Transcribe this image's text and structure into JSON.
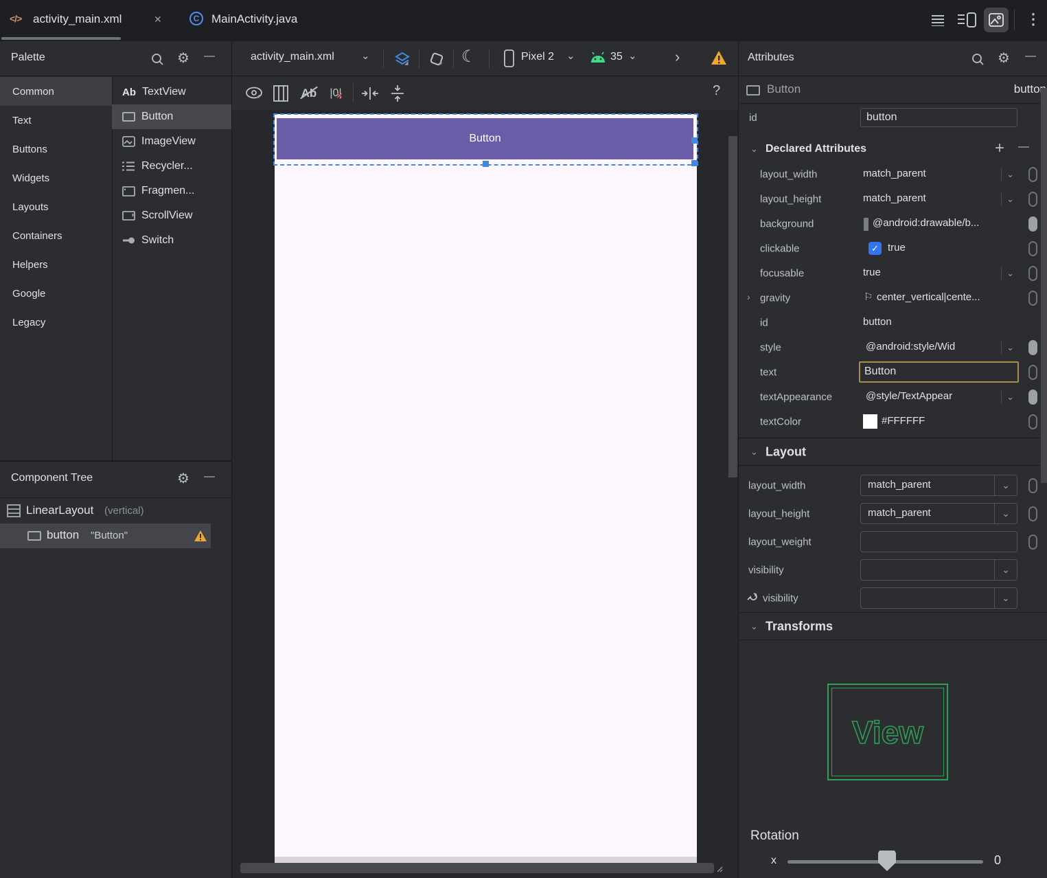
{
  "glyphs": {
    "close": "✕",
    "chevron_down": "⌄",
    "chevron_right": "›",
    "kebab": "⋮",
    "moon": "☾",
    "help": "?",
    "minus": "—",
    "plus": "+",
    "check": "✓",
    "flag": "⚐",
    "gear": "⚙",
    "xml_tag": "</>",
    "java_class": "C",
    "ab": "Ab",
    "weights": "|0|",
    "weights_x": "×",
    "expand": "›"
  },
  "tab_bar": {
    "tabs": [
      {
        "label": "activity_main.xml",
        "active": true
      },
      {
        "label": "MainActivity.java",
        "active": false
      }
    ]
  },
  "palette": {
    "title": "Palette",
    "categories": [
      "Common",
      "Text",
      "Buttons",
      "Widgets",
      "Layouts",
      "Containers",
      "Helpers",
      "Google",
      "Legacy"
    ],
    "selected_category": "Common",
    "components": [
      {
        "label": "TextView"
      },
      {
        "label": "Button"
      },
      {
        "label": "ImageView"
      },
      {
        "label": "Recycler..."
      },
      {
        "label": "Fragmen..."
      },
      {
        "label": "ScrollView"
      },
      {
        "label": "Switch"
      }
    ],
    "selected_component": "Button"
  },
  "component_tree": {
    "title": "Component Tree",
    "root": {
      "label": "LinearLayout",
      "suffix": "(vertical)"
    },
    "child": {
      "label": "button",
      "text": "\"Button\""
    }
  },
  "design_toolbar": {
    "file": "activity_main.xml",
    "device": "Pixel 2",
    "api": "35"
  },
  "canvas": {
    "button_label": "Button"
  },
  "attributes": {
    "title": "Attributes",
    "component": {
      "type": "Button",
      "id": "button"
    },
    "id_row": {
      "label": "id",
      "value": "button"
    },
    "declared": {
      "title": "Declared Attributes",
      "rows": [
        {
          "name": "layout_width",
          "value": "match_parent"
        },
        {
          "name": "layout_height",
          "value": "match_parent"
        },
        {
          "name": "background",
          "value": "@android:drawable/b..."
        },
        {
          "name": "clickable",
          "value": "true"
        },
        {
          "name": "focusable",
          "value": "true"
        },
        {
          "name": "gravity",
          "value": "center_vertical|cente..."
        },
        {
          "name": "id",
          "value": "button"
        },
        {
          "name": "style",
          "value": "@android:style/Wid"
        },
        {
          "name": "text",
          "value": "Button"
        },
        {
          "name": "textAppearance",
          "value": "@style/TextAppear"
        },
        {
          "name": "textColor",
          "value": "#FFFFFF"
        }
      ]
    },
    "layout": {
      "title": "Layout",
      "rows": [
        {
          "name": "layout_width",
          "value": "match_parent"
        },
        {
          "name": "layout_height",
          "value": "match_parent"
        },
        {
          "name": "layout_weight",
          "value": ""
        },
        {
          "name": "visibility",
          "value": ""
        },
        {
          "name": "visibility",
          "value": ""
        }
      ]
    },
    "transforms": {
      "title": "Transforms",
      "preview_label": "View",
      "rotation": {
        "label": "Rotation",
        "axis": "x",
        "value": "0"
      }
    }
  },
  "colors": {
    "accent_blue": "#3F8AE0",
    "checkbox_blue": "#3574F0",
    "purple": "#6B5CA8",
    "warning_orange": "#F0A732",
    "wireframe_green": "#2F9E57",
    "robot_green": "#3DDC84",
    "focus_gold": "#AB8A52",
    "screen_bg": "#FDF7FD",
    "text_color_value": "#FFFFFF"
  }
}
